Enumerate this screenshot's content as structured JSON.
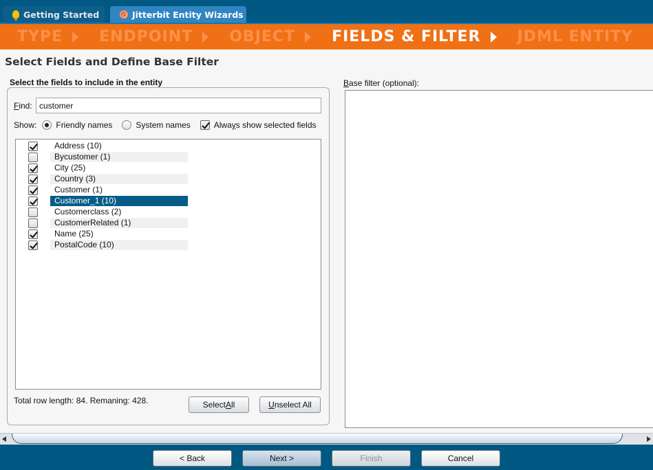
{
  "tabs": [
    {
      "label": "Getting Started",
      "icon": "lightbulb-icon",
      "active": false
    },
    {
      "label": "Jitterbit Entity Wizards",
      "icon": "wizard-icon",
      "active": true
    }
  ],
  "steps": [
    {
      "label": "TYPE",
      "active": false
    },
    {
      "label": "ENDPOINT",
      "active": false
    },
    {
      "label": "OBJECT",
      "active": false
    },
    {
      "label": "FIELDS & FILTER",
      "active": true
    },
    {
      "label": "JDML ENTITY",
      "active": false
    }
  ],
  "page_title": "Select Fields and Define Base Filter",
  "fields_group": {
    "label": "Select the fields to include in the entity",
    "find_label_mnemonic": "F",
    "find_label_rest": "ind:",
    "find_value": "customer",
    "show_label": "Show:",
    "radio_friendly": "Friendly names",
    "radio_system": "System names",
    "selected_radio": "friendly",
    "always_show_pre": "Alwa",
    "always_show_mnemonic": "y",
    "always_show_post": "s show selected fields",
    "always_show_checked": true,
    "fields": [
      {
        "name": "Address (10)",
        "checked": true,
        "selected": false
      },
      {
        "name": "Bycustomer (1)",
        "checked": false,
        "selected": false
      },
      {
        "name": "City (25)",
        "checked": true,
        "selected": false
      },
      {
        "name": "Country (3)",
        "checked": true,
        "selected": false
      },
      {
        "name": "Customer (1)",
        "checked": true,
        "selected": false
      },
      {
        "name": "Customer_1 (10)",
        "checked": true,
        "selected": true
      },
      {
        "name": "Customerclass (2)",
        "checked": false,
        "selected": false
      },
      {
        "name": "CustomerRelated (1)",
        "checked": false,
        "selected": false
      },
      {
        "name": "Name (25)",
        "checked": true,
        "selected": false
      },
      {
        "name": "PostalCode (10)",
        "checked": true,
        "selected": false
      }
    ],
    "total_text": "Total row length: 84. Remaning: 428.",
    "select_all_pre": "Select ",
    "select_all_mnemonic": "A",
    "select_all_post": "ll",
    "unselect_all_mnemonic": "U",
    "unselect_all_post": "nselect All"
  },
  "base_filter": {
    "label_mnemonic": "B",
    "label_rest": "ase filter (optional):",
    "value": ""
  },
  "footer": {
    "back": "< Back",
    "next": "Next >",
    "finish": "Finish",
    "cancel": "Cancel"
  }
}
